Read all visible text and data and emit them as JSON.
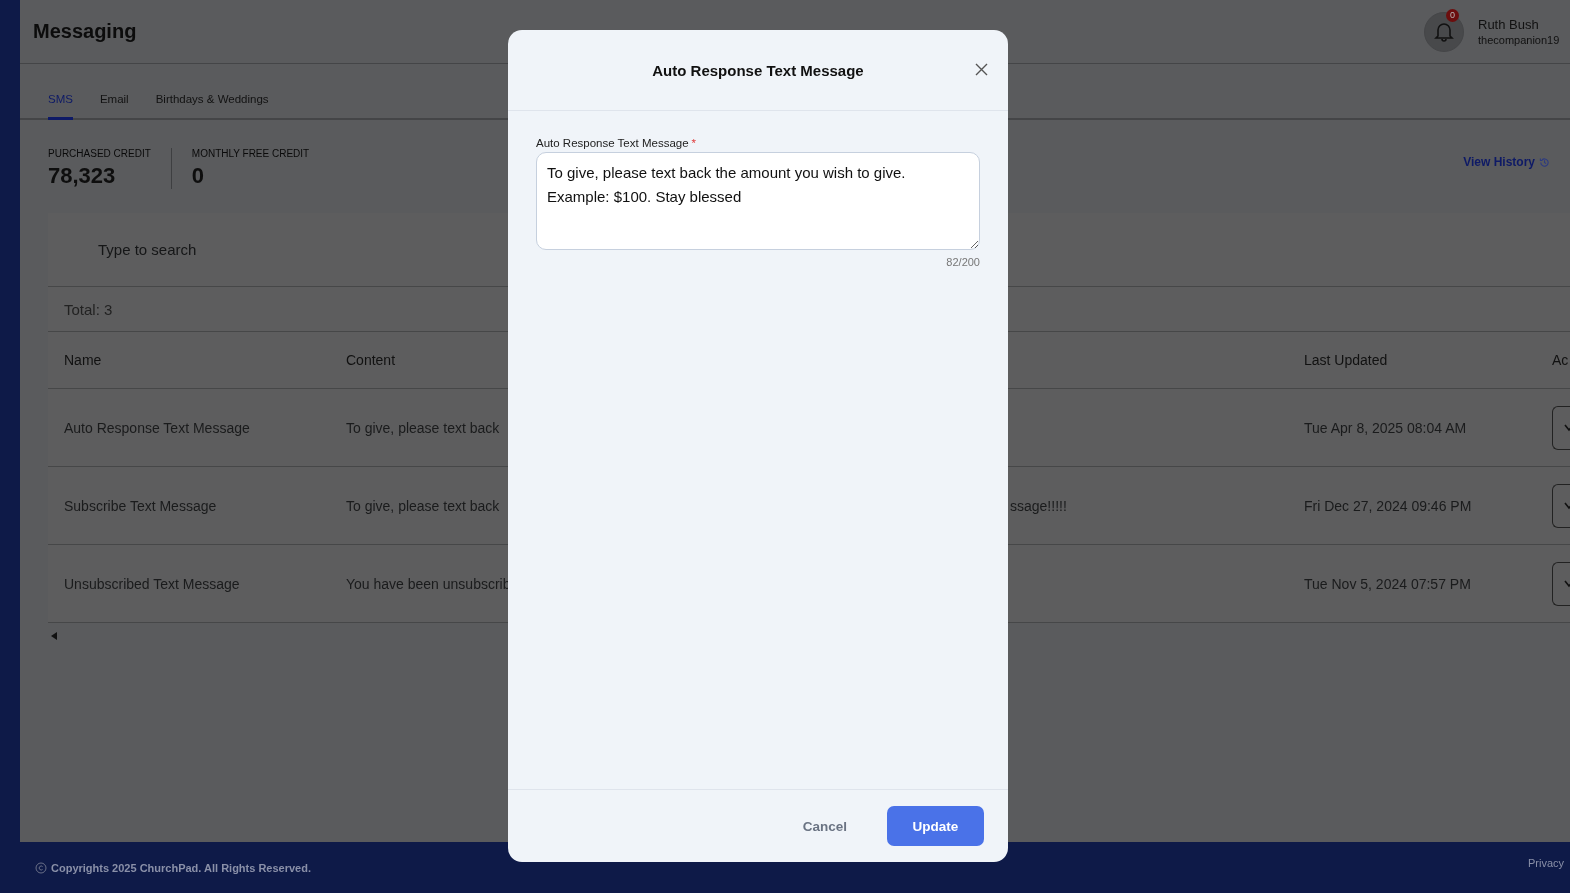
{
  "header": {
    "title": "Messaging",
    "notifications": {
      "count": "0"
    },
    "user": {
      "name": "Ruth Bush",
      "email": "thecompanion19"
    }
  },
  "tabs": [
    {
      "label": "SMS",
      "selected": true
    },
    {
      "label": "Email",
      "selected": false
    },
    {
      "label": "Birthdays & Weddings",
      "selected": false
    }
  ],
  "credits": [
    {
      "label": "PURCHASED CREDIT",
      "value": "78,323"
    },
    {
      "label": "MONTHLY FREE CREDIT",
      "value": "0"
    }
  ],
  "view_history": "View History",
  "search": {
    "placeholder": "Type to search"
  },
  "total": "Total: 3",
  "table": {
    "columns": [
      "Name",
      "Content",
      "Last Updated",
      "Ac"
    ],
    "rows": [
      {
        "name": "Auto Response Text Message",
        "content": "To give, please text back",
        "last_updated": "Tue Apr 8, 2025 08:04 AM"
      },
      {
        "name": "Subscribe Text Message",
        "content": "To give, please text back",
        "content_tail": "ssage!!!!!",
        "last_updated": "Fri Dec 27, 2024 09:46 PM"
      },
      {
        "name": "Unsubscribed Text Message",
        "content": "You have been unsubscrib",
        "last_updated": "Tue Nov 5, 2024 07:57 PM"
      }
    ]
  },
  "footer": {
    "copyright": "Copyrights 2025 ChurchPad. All Rights Reserved.",
    "link": "Privacy"
  },
  "modal": {
    "title": "Auto Response Text Message",
    "field": {
      "label": "Auto Response Text Message",
      "required_mark": "*",
      "value": "To give, please text back the amount you wish to give. Example: $100. Stay blessed",
      "counter": "82/200"
    },
    "buttons": [
      {
        "label": "Cancel",
        "kind": "secondary"
      },
      {
        "label": "Update",
        "kind": "primary"
      }
    ]
  }
}
